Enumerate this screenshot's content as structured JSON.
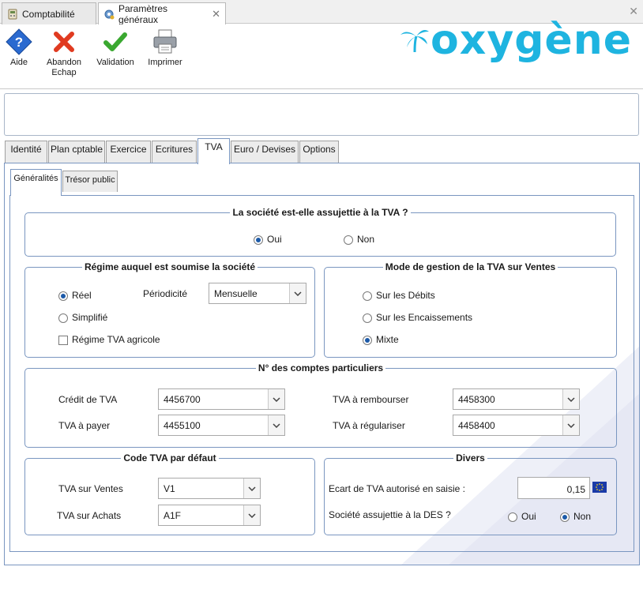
{
  "window_tabs": [
    {
      "label": "Comptabilité"
    },
    {
      "label": "Paramètres généraux"
    }
  ],
  "toolbar": {
    "aide": "Aide",
    "abandon_line1": "Abandon",
    "abandon_line2": "Echap",
    "validation": "Validation",
    "imprimer": "Imprimer"
  },
  "logo": {
    "text": "oxygène"
  },
  "main_tabs": [
    {
      "label": "Identité"
    },
    {
      "label": "Plan cptable"
    },
    {
      "label": "Exercice"
    },
    {
      "label": "Ecritures"
    },
    {
      "label": "TVA"
    },
    {
      "label": "Euro / Devises"
    },
    {
      "label": "Options"
    }
  ],
  "sub_tabs": [
    {
      "label": "Généralités"
    },
    {
      "label": "Trésor public"
    }
  ],
  "assujettie": {
    "title": "La société est-elle assujettie à la TVA ?",
    "oui": "Oui",
    "non": "Non",
    "selected": "Oui"
  },
  "regime": {
    "title": "Régime auquel est soumise la société",
    "reel": "Réel",
    "simplifie": "Simplifié",
    "agricole": "Régime TVA agricole",
    "selected": "Réel",
    "agricole_checked": false,
    "periodicite_label": "Périodicité",
    "periodicite_value": "Mensuelle"
  },
  "mode_gestion": {
    "title": "Mode de gestion de la TVA sur Ventes",
    "debits": "Sur les Débits",
    "encaissements": "Sur les Encaissements",
    "mixte": "Mixte",
    "selected": "Mixte"
  },
  "comptes": {
    "title": "N° des comptes particuliers",
    "credit_label": "Crédit de TVA",
    "credit_value": "4456700",
    "payer_label": "TVA à payer",
    "payer_value": "4455100",
    "rembourser_label": "TVA à rembourser",
    "rembourser_value": "4458300",
    "regulariser_label": "TVA à régulariser",
    "regulariser_value": "4458400"
  },
  "code_tva": {
    "title": "Code TVA par défaut",
    "ventes_label": "TVA sur Ventes",
    "ventes_value": "V1",
    "achats_label": "TVA sur Achats",
    "achats_value": "A1F"
  },
  "divers": {
    "title": "Divers",
    "ecart_label": "Ecart de TVA autorisé en saisie :",
    "ecart_value": "0,15",
    "des_label": "Société assujettie à la DES ?",
    "oui": "Oui",
    "non": "Non",
    "selected": "Non"
  },
  "colors": {
    "accent": "#1c5aa8",
    "border": "#7a96c0",
    "logo": "#1eb4e0"
  }
}
